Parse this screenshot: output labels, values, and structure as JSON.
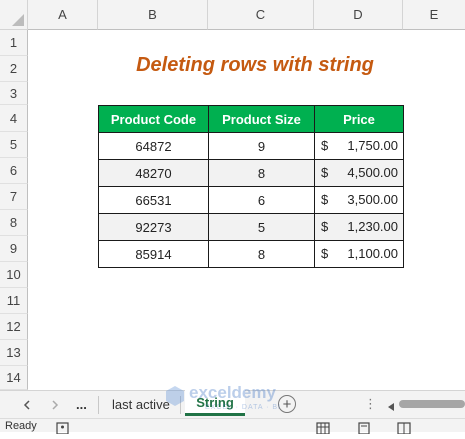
{
  "columns": [
    "A",
    "B",
    "C",
    "D",
    "E"
  ],
  "rows": [
    "1",
    "2",
    "3",
    "4",
    "5",
    "6",
    "7",
    "8",
    "9",
    "10",
    "11",
    "12",
    "13",
    "14"
  ],
  "title": "Deleting rows with string",
  "table": {
    "headers": [
      "Product Code",
      "Product Size",
      "Price"
    ],
    "rows": [
      {
        "code": "64872",
        "size": "9",
        "currency": "$",
        "price": "1,750.00"
      },
      {
        "code": "48270",
        "size": "8",
        "currency": "$",
        "price": "4,500.00"
      },
      {
        "code": "66531",
        "size": "6",
        "currency": "$",
        "price": "3,500.00"
      },
      {
        "code": "92273",
        "size": "5",
        "currency": "$",
        "price": "1,230.00"
      },
      {
        "code": "85914",
        "size": "8",
        "currency": "$",
        "price": "1,100.00"
      }
    ]
  },
  "sheet_tabs": {
    "ellipsis": "...",
    "inactive": "last active",
    "active": "String",
    "add_symbol": "+",
    "more_symbol": "⋮"
  },
  "status": {
    "ready": "Ready"
  },
  "watermark": {
    "brand": "exceldemy",
    "tagline": "EXCEL · DATA · BI"
  },
  "colors": {
    "header_green": "#00b050",
    "title_orange": "#c55a11",
    "active_tab_green": "#217346"
  },
  "icons": [
    "prev-sheet-icon",
    "next-sheet-icon",
    "add-sheet-icon",
    "more-options-icon",
    "scroll-left-icon",
    "accessibility-icon",
    "normal-view-icon",
    "page-layout-icon",
    "page-break-icon"
  ]
}
